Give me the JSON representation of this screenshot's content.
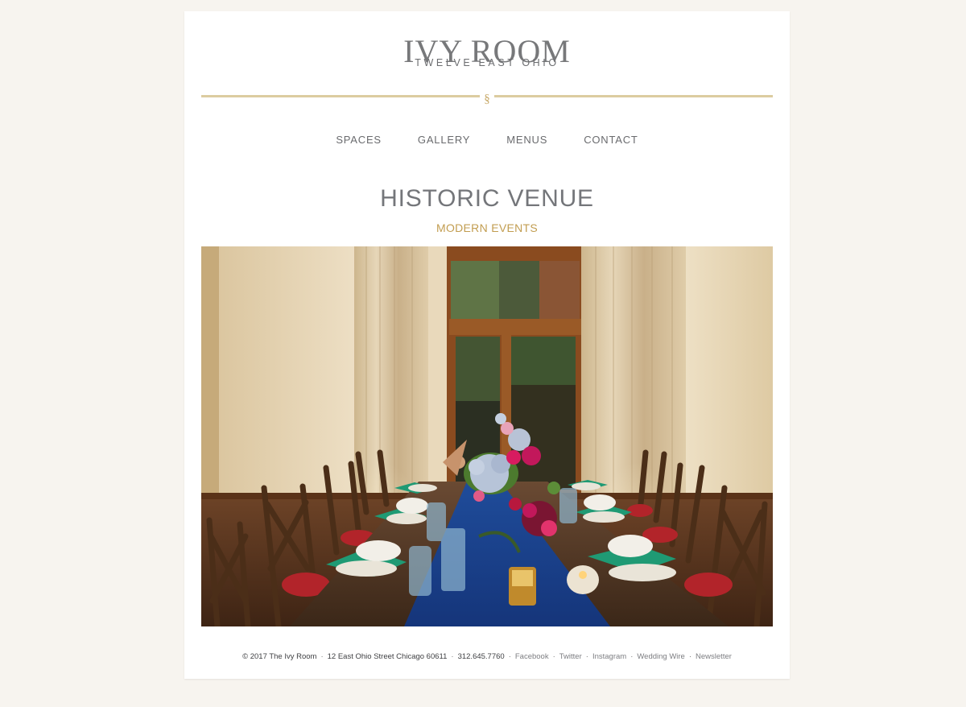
{
  "header": {
    "logo_title": "IVY ROOM",
    "logo_subtitle": "TWELVE EAST OHIO",
    "divider_symbol": "§"
  },
  "nav": {
    "items": [
      {
        "label": "SPACES"
      },
      {
        "label": "GALLERY"
      },
      {
        "label": "MENUS"
      },
      {
        "label": "CONTACT"
      }
    ]
  },
  "hero": {
    "headline": "HISTORIC VENUE",
    "subheadline": "MODERN EVENTS",
    "image_subject": "banquet-table-photo"
  },
  "footer": {
    "copyright": "© 2017 The Ivy Room",
    "address": "12 East Ohio Street Chicago 60611",
    "phone": "312.645.7760",
    "links": [
      "Facebook",
      "Twitter",
      "Instagram",
      "Wedding Wire",
      "Newsletter"
    ]
  },
  "colors": {
    "background": "#f7f4ef",
    "panel": "#ffffff",
    "text_gray": "#74767a",
    "gold_accent": "#c29d50",
    "divider_gold": "#dccca0"
  }
}
